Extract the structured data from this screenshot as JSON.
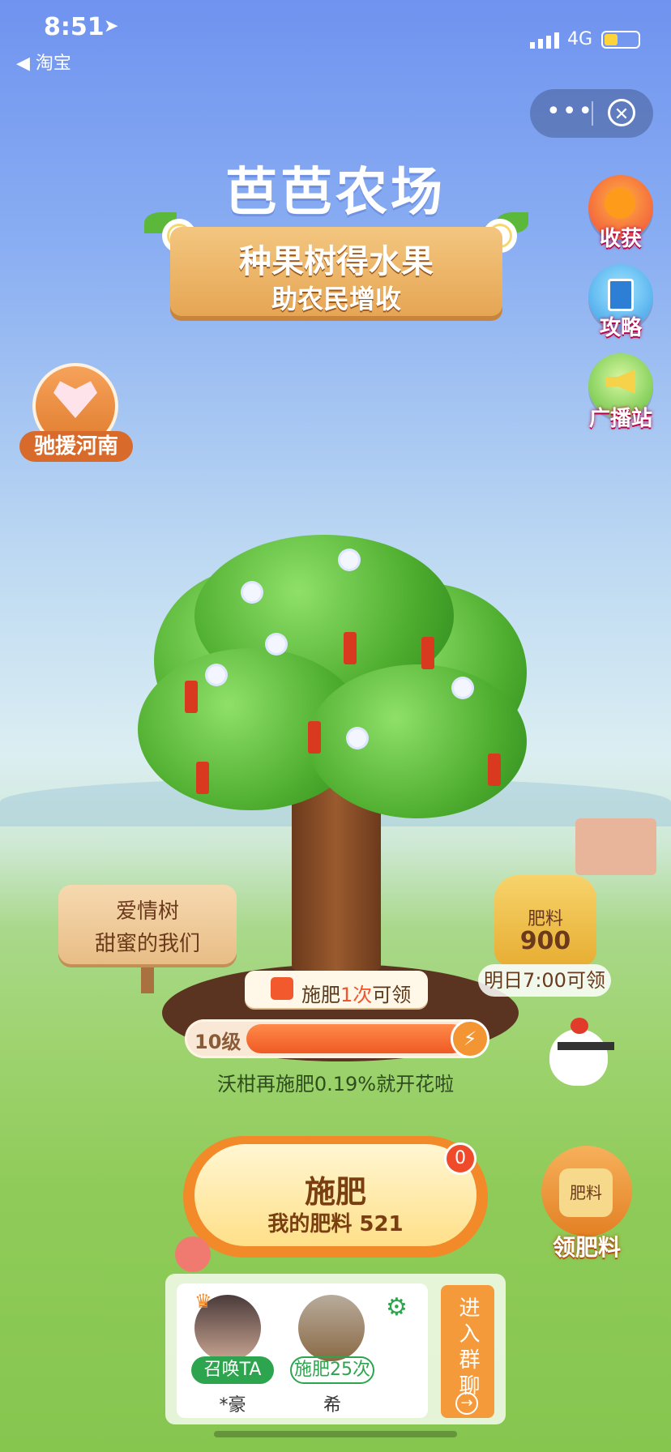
{
  "status_bar": {
    "time": "8:51",
    "back_label": "◀ 淘宝",
    "network": "4G"
  },
  "capsule": {
    "more_label": "•••",
    "close_label": "✕"
  },
  "header": {
    "title": "芭芭农场",
    "banner_line1": "种果树得水果",
    "banner_line2": "助农民增收"
  },
  "side_buttons": [
    {
      "label": "收获",
      "icon": "orange-icon"
    },
    {
      "label": "攻略",
      "icon": "guide-icon"
    },
    {
      "label": "广播站",
      "icon": "megaphone-icon"
    }
  ],
  "left_button": {
    "label": "驰援河南",
    "icon": "heart-icon"
  },
  "sign": {
    "line1": "爱情树",
    "line2": "甜蜜的我们"
  },
  "sack": {
    "title": "肥料",
    "value": "900",
    "hint": "明日7:00可领"
  },
  "fert_notice": {
    "prefix": "施肥",
    "count": "1次",
    "suffix": "可领"
  },
  "progress": {
    "level": "10级",
    "percent": 0.8,
    "hint": "沃柑再施肥0.19%就开花啦"
  },
  "main_button": {
    "label": "施肥",
    "sub": "我的肥料 521",
    "badge": "0"
  },
  "get_fertilizer": {
    "bag_label": "肥料",
    "label": "领肥料"
  },
  "group": {
    "members": [
      {
        "action": "召唤TA",
        "name": "*豪"
      },
      {
        "action": "施肥25次",
        "name": "希"
      }
    ],
    "join_label": "进入群聊",
    "join_arrow": "→"
  },
  "colors": {
    "accent": "#f28a2a",
    "green": "#2da44e",
    "sky": "#6f93ef"
  }
}
